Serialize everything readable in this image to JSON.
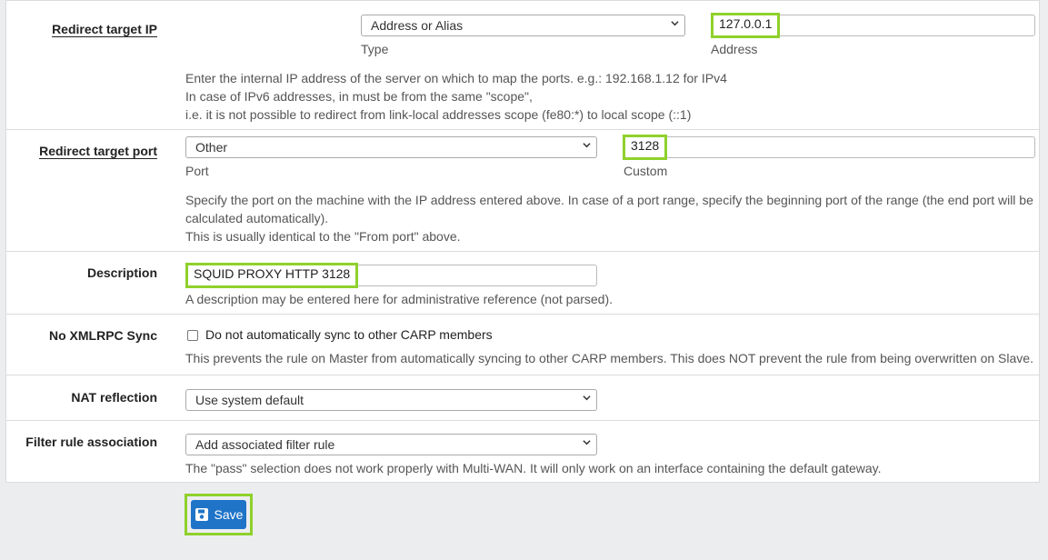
{
  "redirect_ip": {
    "label": "Redirect target IP",
    "type_select": "Address or Alias",
    "type_caption": "Type",
    "address_value": "127.0.0.1",
    "address_caption": "Address",
    "help": [
      "Enter the internal IP address of the server on which to map the ports. e.g.: 192.168.1.12 for IPv4",
      "In case of IPv6 addresses, in must be from the same \"scope\",",
      "i.e. it is not possible to redirect from link-local addresses scope (fe80:*) to local scope (::1)"
    ]
  },
  "redirect_port": {
    "label": "Redirect target port",
    "port_select": "Other",
    "port_caption": "Port",
    "custom_value": "3128",
    "custom_caption": "Custom",
    "help": [
      "Specify the port on the machine with the IP address entered above. In case of a port range, specify the beginning port of the range (the end port will be",
      "calculated automatically).",
      "This is usually identical to the \"From port\" above."
    ]
  },
  "description": {
    "label": "Description",
    "value": "SQUID PROXY HTTP 3128",
    "help": "A description may be entered here for administrative reference (not parsed)."
  },
  "xmlrpc": {
    "label": "No XMLRPC Sync",
    "checkbox_label": "Do not automatically sync to other CARP members",
    "checked": false,
    "help": "This prevents the rule on Master from automatically syncing to other CARP members. This does NOT prevent the rule from being overwritten on Slave."
  },
  "nat_reflection": {
    "label": "NAT reflection",
    "select": "Use system default"
  },
  "filter_rule": {
    "label": "Filter rule association",
    "select": "Add associated filter rule",
    "help": "The \"pass\" selection does not work properly with Multi-WAN. It will only work on an interface containing the default gateway."
  },
  "save_label": "Save",
  "colors": {
    "highlight": "#8fd12b",
    "primary_button": "#1f74c8"
  }
}
